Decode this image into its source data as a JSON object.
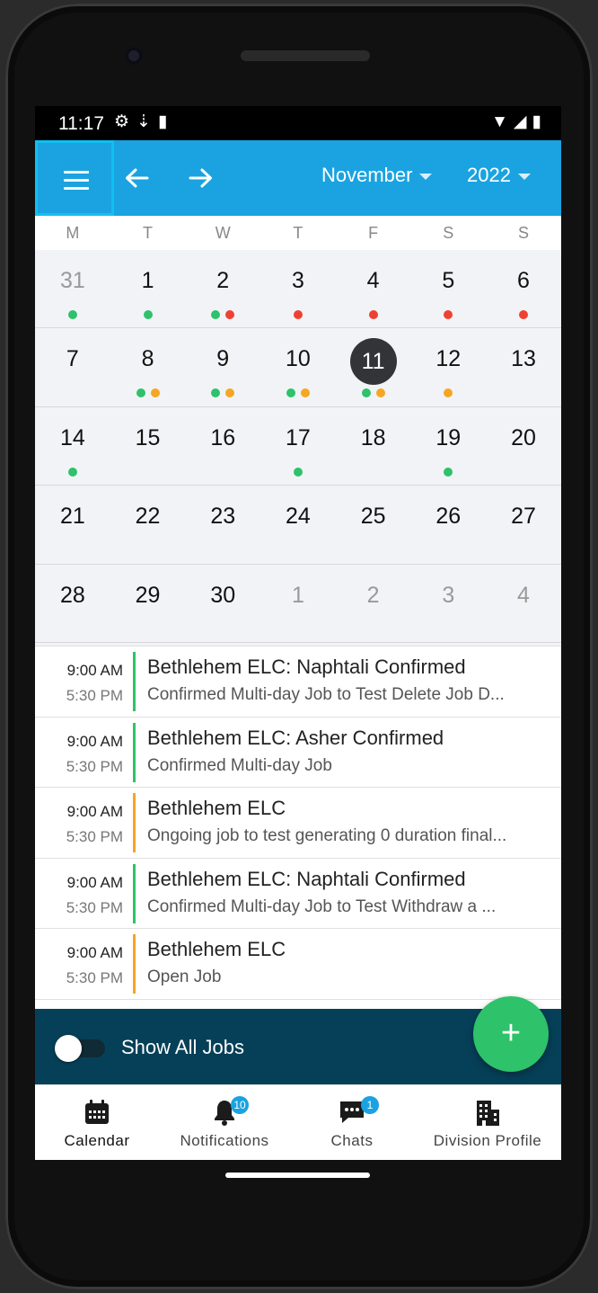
{
  "status_bar": {
    "time": "11:17"
  },
  "header": {
    "month": "November",
    "year": "2022"
  },
  "calendar": {
    "weekdays": [
      "M",
      "T",
      "W",
      "T",
      "F",
      "S",
      "S"
    ],
    "weeks": [
      [
        {
          "d": "31",
          "out": true,
          "dots": [
            "#2ec26a"
          ]
        },
        {
          "d": "1",
          "dots": [
            "#2ec26a"
          ]
        },
        {
          "d": "2",
          "dots": [
            "#2ec26a",
            "#ef4131"
          ]
        },
        {
          "d": "3",
          "dots": [
            "#ef4131"
          ]
        },
        {
          "d": "4",
          "dots": [
            "#ef4131"
          ]
        },
        {
          "d": "5",
          "dots": [
            "#ef4131"
          ]
        },
        {
          "d": "6",
          "dots": [
            "#ef4131"
          ]
        }
      ],
      [
        {
          "d": "7",
          "dots": []
        },
        {
          "d": "8",
          "dots": [
            "#2ec26a",
            "#f5a623"
          ]
        },
        {
          "d": "9",
          "dots": [
            "#2ec26a",
            "#f5a623"
          ]
        },
        {
          "d": "10",
          "dots": [
            "#2ec26a",
            "#f5a623"
          ]
        },
        {
          "d": "11",
          "today": true,
          "dots": [
            "#2ec26a",
            "#f5a623"
          ]
        },
        {
          "d": "12",
          "dots": [
            "#f5a623"
          ]
        },
        {
          "d": "13",
          "dots": []
        }
      ],
      [
        {
          "d": "14",
          "dots": [
            "#2ec26a"
          ]
        },
        {
          "d": "15",
          "dots": []
        },
        {
          "d": "16",
          "dots": []
        },
        {
          "d": "17",
          "dots": [
            "#2ec26a"
          ]
        },
        {
          "d": "18",
          "dots": []
        },
        {
          "d": "19",
          "dots": [
            "#2ec26a"
          ]
        },
        {
          "d": "20",
          "dots": []
        }
      ],
      [
        {
          "d": "21",
          "dots": []
        },
        {
          "d": "22",
          "dots": []
        },
        {
          "d": "23",
          "dots": []
        },
        {
          "d": "24",
          "dots": []
        },
        {
          "d": "25",
          "dots": []
        },
        {
          "d": "26",
          "dots": []
        },
        {
          "d": "27",
          "dots": []
        }
      ],
      [
        {
          "d": "28",
          "dots": []
        },
        {
          "d": "29",
          "dots": []
        },
        {
          "d": "30",
          "dots": []
        },
        {
          "d": "1",
          "out": true,
          "dots": []
        },
        {
          "d": "2",
          "out": true,
          "dots": []
        },
        {
          "d": "3",
          "out": true,
          "dots": []
        },
        {
          "d": "4",
          "out": true,
          "dots": []
        }
      ]
    ]
  },
  "jobs": [
    {
      "start": "9:00 AM",
      "end": "5:30 PM",
      "title": "Bethlehem ELC: Naphtali Confirmed",
      "desc": "Confirmed Multi-day Job to Test Delete Job D...",
      "color": "#2ec26a"
    },
    {
      "start": "9:00 AM",
      "end": "5:30 PM",
      "title": "Bethlehem ELC: Asher Confirmed",
      "desc": "Confirmed Multi-day Job",
      "color": "#2ec26a"
    },
    {
      "start": "9:00 AM",
      "end": "5:30 PM",
      "title": "Bethlehem ELC",
      "desc": "Ongoing job to test generating 0 duration final...",
      "color": "#f5a623"
    },
    {
      "start": "9:00 AM",
      "end": "5:30 PM",
      "title": "Bethlehem ELC: Naphtali Confirmed",
      "desc": "Confirmed Multi-day Job to Test Withdraw a ...",
      "color": "#2ec26a"
    },
    {
      "start": "9:00 AM",
      "end": "5:30 PM",
      "title": "Bethlehem ELC",
      "desc": "Open Job",
      "color": "#f5a623"
    }
  ],
  "toggle": {
    "label": "Show All Jobs",
    "on": false
  },
  "fab": {
    "label": "+"
  },
  "nav": {
    "calendar": "Calendar",
    "notifications": "Notifications",
    "notifications_badge": "10",
    "chats": "Chats",
    "chats_badge": "1",
    "division_profile": "Division Profile"
  }
}
